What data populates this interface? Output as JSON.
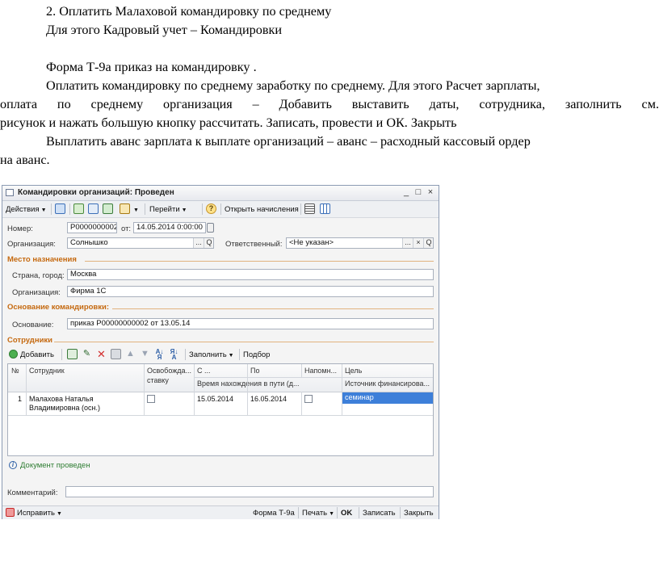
{
  "document": {
    "line1": "2. Оплатить Малаховой командировку по среднему",
    "line2": "Для этого Кадровый учет – Командировки",
    "line3": "Форма Т-9а приказ на командировку .",
    "para1_line1": "Оплатить командировку по среднему заработку по среднему. Для этого Расчет зарплаты,",
    "para1_line2": "оплата по среднему организация – Добавить выставить даты, сотрудника, заполнить см.",
    "para1_line3": "рисунок и нажать большую кнопку рассчитать. Записать, провести и ОК. Закрыть",
    "para2_line1": "Выплатить аванс зарплата к выплате организаций – аванс – расходный кассовый ордер",
    "para2_line2": "на аванс."
  },
  "window": {
    "title": "Командировки организаций: Проведен",
    "controls": {
      "minimize": "_",
      "maximize": "□",
      "close": "×"
    }
  },
  "toolbar": {
    "actions": "Действия",
    "goto": "Перейти",
    "help": "?",
    "open_accruals": "Открыть начисления"
  },
  "header": {
    "number_label": "Номер:",
    "number_value": "Р0000000002",
    "date_label": "от:",
    "date_value": "14.05.2014  0:00:00",
    "org_label": "Организация:",
    "org_value": "Солнышко",
    "resp_label": "Ответственный:",
    "resp_value": "<Не указан>",
    "btn_dots": "...",
    "btn_clear": "×",
    "btn_search": "Q"
  },
  "destination": {
    "section": "Место назначения",
    "country_label": "Страна, город:",
    "country_value": "Москва",
    "org_label": "Организация:",
    "org_value": "Фирма 1С"
  },
  "basis": {
    "section": "Основание командировки:",
    "label": "Основание:",
    "value": "приказ Р00000000002 от 13.05.14"
  },
  "employees": {
    "section": "Сотрудники",
    "add": "Добавить",
    "fill": "Заполнить",
    "select": "Подбор",
    "columns": {
      "num": "№",
      "employee": "Сотрудник",
      "release_1": "Освобожда...",
      "release_2": "ставку",
      "from": "С ...",
      "to": "По",
      "remind": "Напомн...",
      "goal": "Цель",
      "time_on_road": "Время нахождения в пути (д...",
      "funding": "Источник финансирова..."
    },
    "rows": [
      {
        "num": "1",
        "employee_line1": "Малахова Наталья",
        "employee_line2": "Владимировна  (осн.)",
        "release": false,
        "from": "15.05.2014",
        "to": "16.05.2014",
        "remind": false,
        "goal": "семинар"
      }
    ]
  },
  "info": {
    "posted": "Документ проведен",
    "icon": "i"
  },
  "comment_label": "Комментарий:",
  "comment_value": "",
  "statusbar": {
    "fix": "Исправить",
    "form": "Форма Т-9а",
    "print": "Печать",
    "ok": "OK",
    "save": "Записать",
    "close": "Закрыть"
  }
}
